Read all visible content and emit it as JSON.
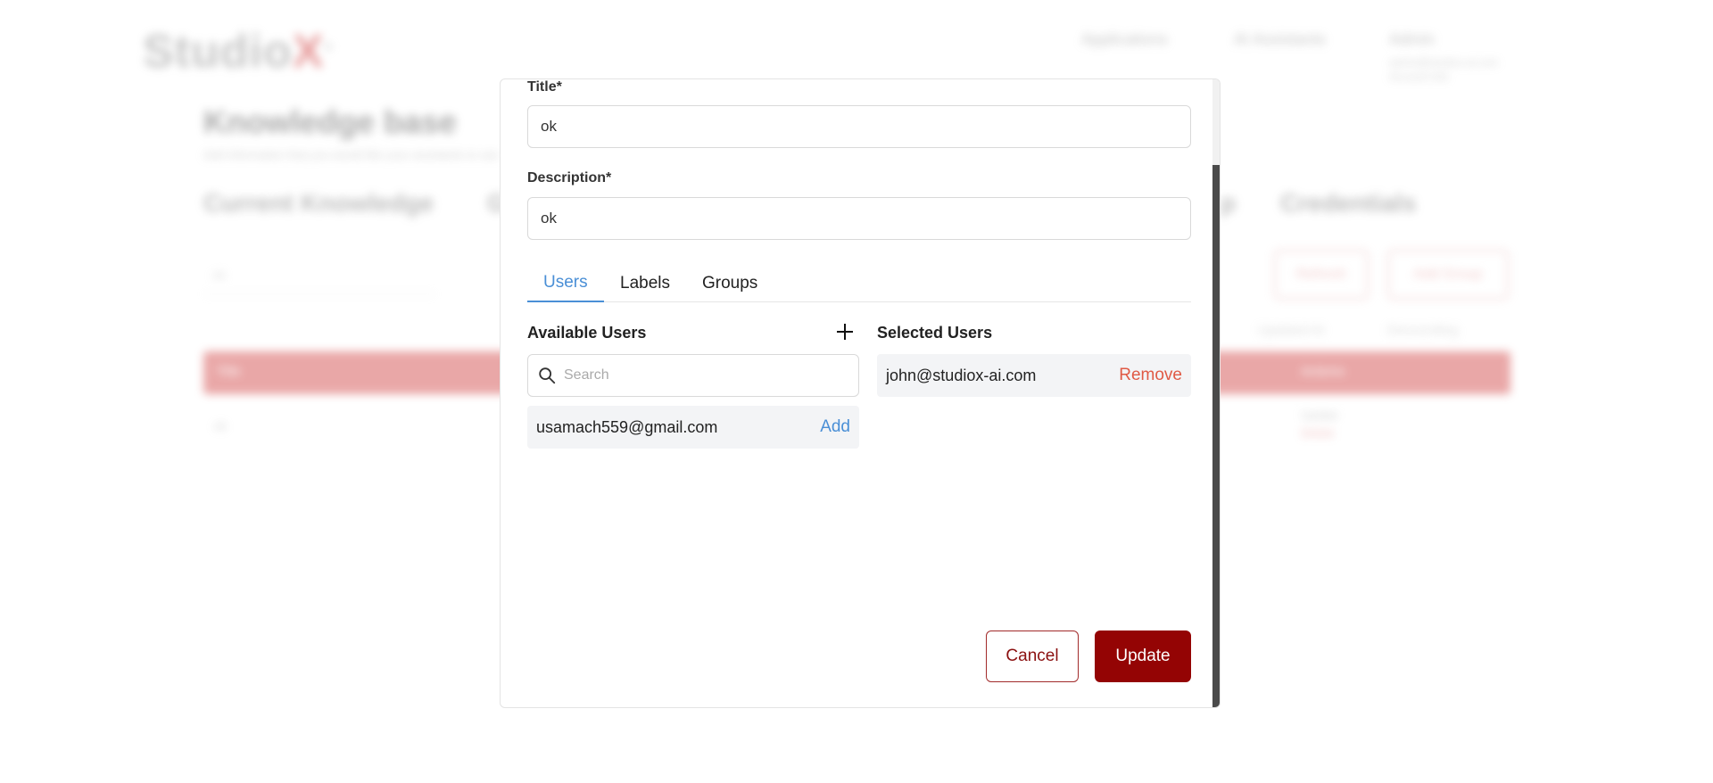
{
  "background": {
    "logo_main": "Studio",
    "logo_accent": "X",
    "logo_mark": "®",
    "nav": [
      "Applications",
      "AI Assistants"
    ],
    "admin_name": "Admin",
    "admin_email": "admin@studiox-ai.com",
    "admin_role": "Account Info",
    "page_title": "Knowledge base",
    "page_subtitle": "Add information that you would like your assistants to use",
    "tabs": [
      "Current Knowledge",
      "G",
      "p",
      "Credentials"
    ],
    "select_value": "ok",
    "buttons": [
      "Refresh",
      "Add Group"
    ],
    "filters": [
      "Updated At",
      "Descending"
    ],
    "table_head_left": "Title",
    "table_head_right": "Actions",
    "row_cell": "ok",
    "row_action_update": "Update",
    "row_action_delete": "Delete"
  },
  "modal": {
    "title_label": "Title*",
    "title_value": "ok",
    "description_label": "Description*",
    "description_value": "ok",
    "tabs": [
      {
        "label": "Users",
        "active": true
      },
      {
        "label": "Labels",
        "active": false
      },
      {
        "label": "Groups",
        "active": false
      }
    ],
    "available_users": {
      "title": "Available Users",
      "search_placeholder": "Search",
      "items": [
        {
          "email": "usamach559@gmail.com",
          "action": "Add"
        }
      ]
    },
    "selected_users": {
      "title": "Selected Users",
      "items": [
        {
          "email": "john@studiox-ai.com",
          "action": "Remove"
        }
      ]
    },
    "cancel_label": "Cancel",
    "update_label": "Update"
  },
  "colors": {
    "accent_blue": "#4a8fd6",
    "primary_red": "#940404",
    "remove_red": "#e05a45"
  }
}
